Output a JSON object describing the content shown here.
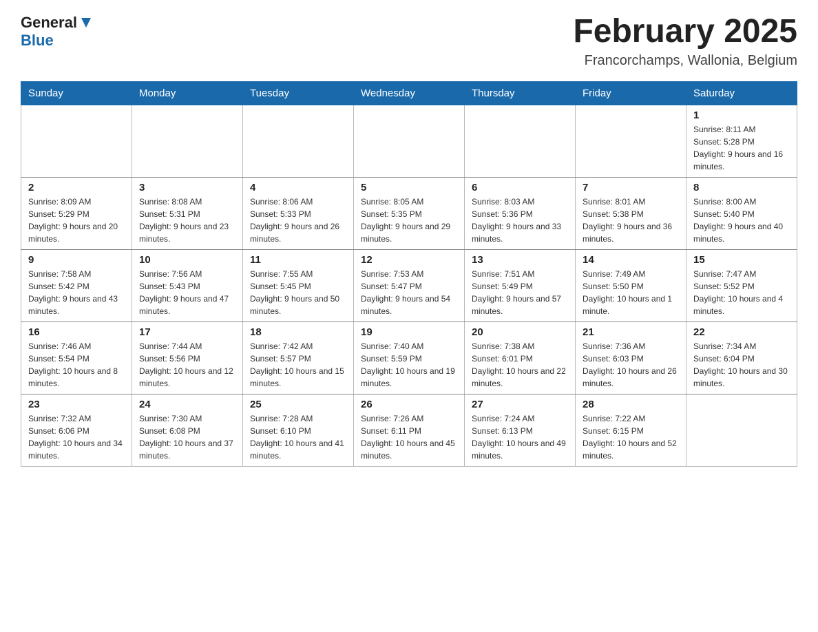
{
  "header": {
    "logo": {
      "general": "General",
      "blue": "Blue",
      "tagline": ""
    },
    "month_title": "February 2025",
    "location": "Francorchamps, Wallonia, Belgium"
  },
  "days_of_week": [
    "Sunday",
    "Monday",
    "Tuesday",
    "Wednesday",
    "Thursday",
    "Friday",
    "Saturday"
  ],
  "weeks": [
    [
      {
        "day": "",
        "info": ""
      },
      {
        "day": "",
        "info": ""
      },
      {
        "day": "",
        "info": ""
      },
      {
        "day": "",
        "info": ""
      },
      {
        "day": "",
        "info": ""
      },
      {
        "day": "",
        "info": ""
      },
      {
        "day": "1",
        "info": "Sunrise: 8:11 AM\nSunset: 5:28 PM\nDaylight: 9 hours and 16 minutes."
      }
    ],
    [
      {
        "day": "2",
        "info": "Sunrise: 8:09 AM\nSunset: 5:29 PM\nDaylight: 9 hours and 20 minutes."
      },
      {
        "day": "3",
        "info": "Sunrise: 8:08 AM\nSunset: 5:31 PM\nDaylight: 9 hours and 23 minutes."
      },
      {
        "day": "4",
        "info": "Sunrise: 8:06 AM\nSunset: 5:33 PM\nDaylight: 9 hours and 26 minutes."
      },
      {
        "day": "5",
        "info": "Sunrise: 8:05 AM\nSunset: 5:35 PM\nDaylight: 9 hours and 29 minutes."
      },
      {
        "day": "6",
        "info": "Sunrise: 8:03 AM\nSunset: 5:36 PM\nDaylight: 9 hours and 33 minutes."
      },
      {
        "day": "7",
        "info": "Sunrise: 8:01 AM\nSunset: 5:38 PM\nDaylight: 9 hours and 36 minutes."
      },
      {
        "day": "8",
        "info": "Sunrise: 8:00 AM\nSunset: 5:40 PM\nDaylight: 9 hours and 40 minutes."
      }
    ],
    [
      {
        "day": "9",
        "info": "Sunrise: 7:58 AM\nSunset: 5:42 PM\nDaylight: 9 hours and 43 minutes."
      },
      {
        "day": "10",
        "info": "Sunrise: 7:56 AM\nSunset: 5:43 PM\nDaylight: 9 hours and 47 minutes."
      },
      {
        "day": "11",
        "info": "Sunrise: 7:55 AM\nSunset: 5:45 PM\nDaylight: 9 hours and 50 minutes."
      },
      {
        "day": "12",
        "info": "Sunrise: 7:53 AM\nSunset: 5:47 PM\nDaylight: 9 hours and 54 minutes."
      },
      {
        "day": "13",
        "info": "Sunrise: 7:51 AM\nSunset: 5:49 PM\nDaylight: 9 hours and 57 minutes."
      },
      {
        "day": "14",
        "info": "Sunrise: 7:49 AM\nSunset: 5:50 PM\nDaylight: 10 hours and 1 minute."
      },
      {
        "day": "15",
        "info": "Sunrise: 7:47 AM\nSunset: 5:52 PM\nDaylight: 10 hours and 4 minutes."
      }
    ],
    [
      {
        "day": "16",
        "info": "Sunrise: 7:46 AM\nSunset: 5:54 PM\nDaylight: 10 hours and 8 minutes."
      },
      {
        "day": "17",
        "info": "Sunrise: 7:44 AM\nSunset: 5:56 PM\nDaylight: 10 hours and 12 minutes."
      },
      {
        "day": "18",
        "info": "Sunrise: 7:42 AM\nSunset: 5:57 PM\nDaylight: 10 hours and 15 minutes."
      },
      {
        "day": "19",
        "info": "Sunrise: 7:40 AM\nSunset: 5:59 PM\nDaylight: 10 hours and 19 minutes."
      },
      {
        "day": "20",
        "info": "Sunrise: 7:38 AM\nSunset: 6:01 PM\nDaylight: 10 hours and 22 minutes."
      },
      {
        "day": "21",
        "info": "Sunrise: 7:36 AM\nSunset: 6:03 PM\nDaylight: 10 hours and 26 minutes."
      },
      {
        "day": "22",
        "info": "Sunrise: 7:34 AM\nSunset: 6:04 PM\nDaylight: 10 hours and 30 minutes."
      }
    ],
    [
      {
        "day": "23",
        "info": "Sunrise: 7:32 AM\nSunset: 6:06 PM\nDaylight: 10 hours and 34 minutes."
      },
      {
        "day": "24",
        "info": "Sunrise: 7:30 AM\nSunset: 6:08 PM\nDaylight: 10 hours and 37 minutes."
      },
      {
        "day": "25",
        "info": "Sunrise: 7:28 AM\nSunset: 6:10 PM\nDaylight: 10 hours and 41 minutes."
      },
      {
        "day": "26",
        "info": "Sunrise: 7:26 AM\nSunset: 6:11 PM\nDaylight: 10 hours and 45 minutes."
      },
      {
        "day": "27",
        "info": "Sunrise: 7:24 AM\nSunset: 6:13 PM\nDaylight: 10 hours and 49 minutes."
      },
      {
        "day": "28",
        "info": "Sunrise: 7:22 AM\nSunset: 6:15 PM\nDaylight: 10 hours and 52 minutes."
      },
      {
        "day": "",
        "info": ""
      }
    ]
  ]
}
